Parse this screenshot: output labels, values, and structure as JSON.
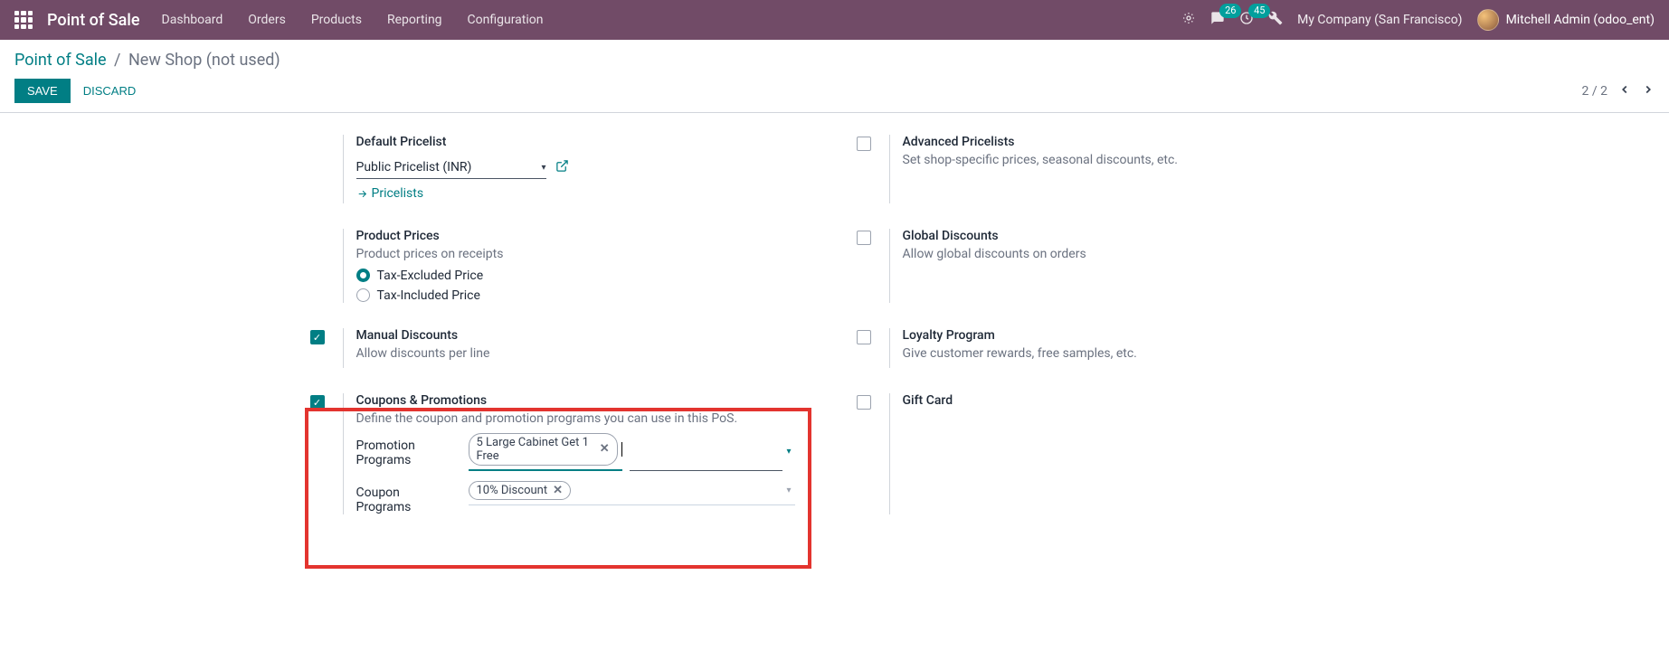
{
  "nav": {
    "app_title": "Point of Sale",
    "menu": [
      "Dashboard",
      "Orders",
      "Products",
      "Reporting",
      "Configuration"
    ],
    "msg_badge": "26",
    "act_badge": "45",
    "company": "My Company (San Francisco)",
    "user": "Mitchell Admin (odoo_ent)"
  },
  "breadcrumb": {
    "root": "Point of Sale",
    "current": "New Shop (not used)"
  },
  "actions": {
    "save": "SAVE",
    "discard": "DISCARD"
  },
  "pager": {
    "text": "2 / 2"
  },
  "settings": {
    "default_pricelist": {
      "title": "Default Pricelist",
      "value": "Public Pricelist (INR)",
      "link": "Pricelists"
    },
    "advanced_pricelists": {
      "title": "Advanced Pricelists",
      "desc": "Set shop-specific prices, seasonal discounts, etc."
    },
    "product_prices": {
      "title": "Product Prices",
      "desc": "Product prices on receipts",
      "opt1": "Tax-Excluded Price",
      "opt2": "Tax-Included Price"
    },
    "global_discounts": {
      "title": "Global Discounts",
      "desc": "Allow global discounts on orders"
    },
    "manual_discounts": {
      "title": "Manual Discounts",
      "desc": "Allow discounts per line"
    },
    "loyalty": {
      "title": "Loyalty Program",
      "desc": "Give customer rewards, free samples, etc."
    },
    "coupons": {
      "title": "Coupons & Promotions",
      "desc": "Define the coupon and promotion programs you can use in this PoS.",
      "promo_label": "Promotion Programs",
      "promo_tag": "5 Large Cabinet Get 1 Free",
      "coupon_label": "Coupon Programs",
      "coupon_tag": "10% Discount"
    },
    "gift_card": {
      "title": "Gift Card"
    }
  }
}
